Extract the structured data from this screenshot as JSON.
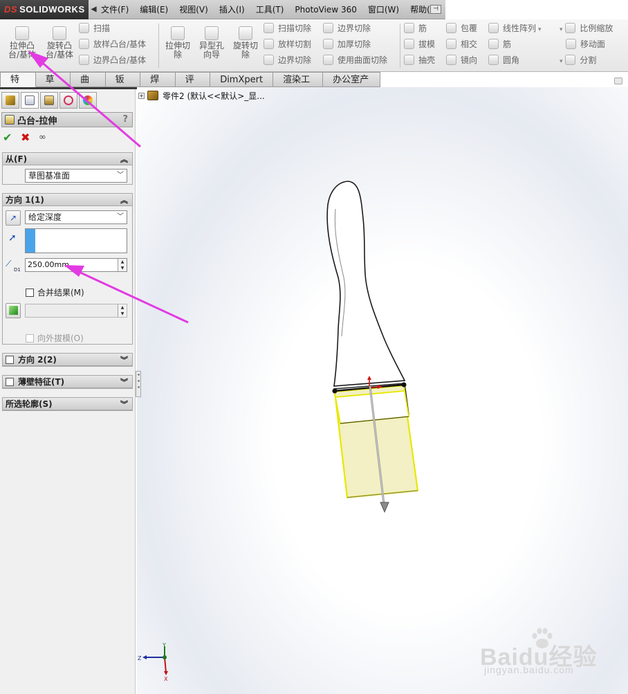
{
  "app": {
    "logo_text": "SOLIDWORKS",
    "logo_prefix": "DS"
  },
  "menu": [
    {
      "label": "文件(F)"
    },
    {
      "label": "编辑(E)"
    },
    {
      "label": "视图(V)"
    },
    {
      "label": "插入(I)"
    },
    {
      "label": "工具(T)"
    },
    {
      "label": "PhotoView 360"
    },
    {
      "label": "窗口(W)"
    },
    {
      "label": "帮助(H)"
    }
  ],
  "ribbon": {
    "extrude_boss": "拉伸凸\n台/基体",
    "revolve_boss": "旋转凸\n台/基体",
    "sweep": "扫描",
    "loft_boss": "放样凸台/基体",
    "boundary_boss": "边界凸台/基体",
    "extrude_cut": "拉伸切\n除",
    "hole_wizard": "异型孔\n向导",
    "revolve_cut": "旋转切\n除",
    "swept_cut": "扫描切除",
    "lofted_cut": "放样切割",
    "boundary_cut": "边界切除",
    "boundary_cut2": "边界切除",
    "thicken_cut": "加厚切除",
    "surface_cut": "使用曲面切除",
    "rib": "筋",
    "draft": "拔模",
    "shell": "抽壳",
    "wrap": "包覆",
    "intersect": "相交",
    "mirror": "镜向",
    "linear_pattern": "线性阵列",
    "rib2": "筋",
    "fillet": "圆角",
    "scale": "比例缩放",
    "move_face": "移动面",
    "split": "分割"
  },
  "tabs": [
    {
      "label": "特征",
      "active": true
    },
    {
      "label": "草图"
    },
    {
      "label": "曲面"
    },
    {
      "label": "钣金"
    },
    {
      "label": "焊件"
    },
    {
      "label": "评估"
    },
    {
      "label": "DimXpert"
    },
    {
      "label": "渲染工具"
    },
    {
      "label": "办公室产品"
    }
  ],
  "property_manager": {
    "title": "凸台-拉伸",
    "help": "?",
    "from": {
      "title": "从(F)",
      "value": "草图基准面"
    },
    "direction1": {
      "title": "方向 1(1)",
      "end_condition": "给定深度",
      "depth": "250.00mm",
      "depth_icon_label": "D1",
      "merge_label": "合并结果(M)",
      "draft_outward": "向外拔模(O)"
    },
    "direction2": {
      "title": "方向 2(2)"
    },
    "thin_feature": {
      "title": "薄壁特征(T)"
    },
    "selected_contours": {
      "title": "所选轮廓(S)"
    }
  },
  "tree": {
    "root_label": "零件2  (默认<<默认>_显..."
  },
  "triad": {
    "x": "X",
    "y": "Y",
    "z": "Z"
  },
  "watermark": {
    "logo": "Baidu经验",
    "url": "jingyan.baidu.com"
  },
  "colors": {
    "annotation_arrow": "#e23be2",
    "preview_yellow": "#f1f0c0",
    "preview_edge": "#e6e600",
    "accent_blue": "#4aa3ea"
  }
}
